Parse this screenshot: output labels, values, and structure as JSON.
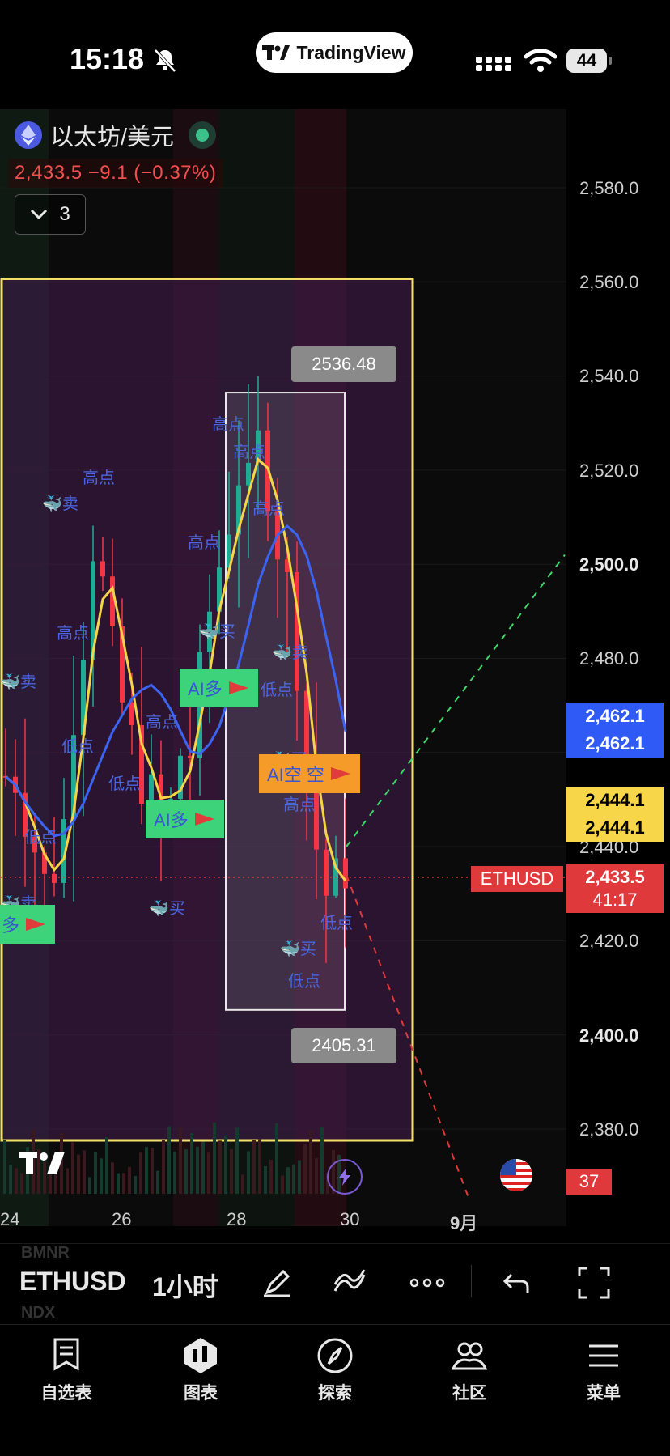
{
  "status_bar": {
    "time": "15:18",
    "app_pill": "TradingView",
    "battery": "44"
  },
  "chart": {
    "symbol_name": "以太坊/美元",
    "price_line": "2,433.5  −9.1 (−0.37%)",
    "collapse_count": "3",
    "y_axis_labels": [
      {
        "text": "2,580.0",
        "bold": false
      },
      {
        "text": "2,560.0",
        "bold": false
      },
      {
        "text": "2,540.0",
        "bold": false
      },
      {
        "text": "2,520.0",
        "bold": false
      },
      {
        "text": "2,500.0",
        "bold": true
      },
      {
        "text": "2,480.0",
        "bold": false
      },
      {
        "text": "2,440.0",
        "bold": false
      },
      {
        "text": "2,420.0",
        "bold": false
      },
      {
        "text": "2,400.0",
        "bold": true
      },
      {
        "text": "2,380.0",
        "bold": false
      }
    ],
    "blue_tag_1": "2,462.1",
    "blue_tag_2": "2,462.1",
    "yellow_tag_1": "2,444.1",
    "yellow_tag_2": "2,444.1",
    "red_tag_price": "2,433.5",
    "red_tag_countdown": "41:17",
    "ethusd_label": "ETHUSD",
    "x_axis_labels": [
      "24",
      "26",
      "28",
      "30",
      "9月"
    ],
    "range_high": "2536.48",
    "range_low": "2405.31",
    "alert_count": "37",
    "annotations": {
      "sell": "卖",
      "buy": "买",
      "high": "高点",
      "low": "低点",
      "ai_long": "AI多",
      "ai_short": "AI空",
      "short_box_extra": "AI空 空"
    },
    "colors": {
      "up": "#22ab94",
      "down": "#f23645",
      "ma_yellow": "#f5d547",
      "ma_blue": "#3b64f3",
      "box_yellow": "#f5e06a"
    }
  },
  "toolbar": {
    "ghost_top": "BMNR",
    "ghost_bottom": "NDX",
    "symbol": "ETHUSD",
    "interval": "1小时"
  },
  "bottom_nav": [
    {
      "label": "自选表",
      "icon": "watchlist-icon"
    },
    {
      "label": "图表",
      "icon": "chart-icon"
    },
    {
      "label": "探索",
      "icon": "compass-icon"
    },
    {
      "label": "社区",
      "icon": "community-icon"
    },
    {
      "label": "菜单",
      "icon": "menu-icon"
    }
  ]
}
